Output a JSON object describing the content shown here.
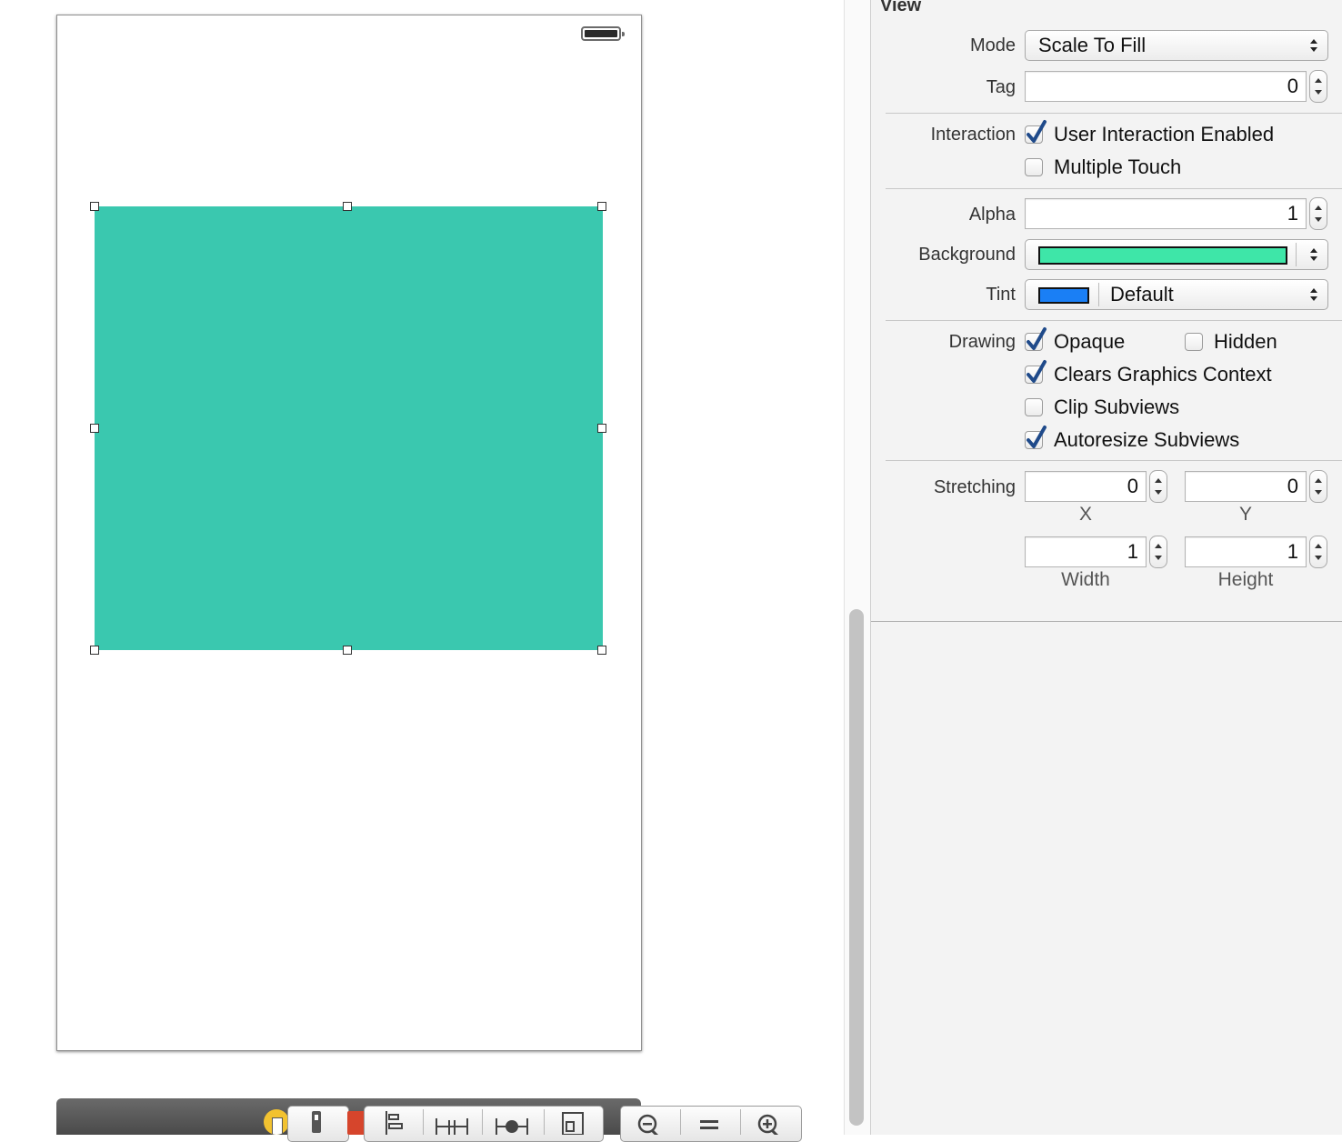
{
  "inspector": {
    "section_title": "View",
    "mode": {
      "label": "Mode",
      "value": "Scale To Fill"
    },
    "tag": {
      "label": "Tag",
      "value": "0"
    },
    "interaction": {
      "label": "Interaction",
      "user_interaction_enabled": {
        "label": "User Interaction Enabled",
        "checked": true
      },
      "multiple_touch": {
        "label": "Multiple Touch",
        "checked": false
      }
    },
    "alpha": {
      "label": "Alpha",
      "value": "1"
    },
    "background": {
      "label": "Background",
      "color": "#3ee6a8"
    },
    "tint": {
      "label": "Tint",
      "value": "Default",
      "color": "#1a7ff5"
    },
    "drawing": {
      "label": "Drawing",
      "opaque": {
        "label": "Opaque",
        "checked": true
      },
      "hidden": {
        "label": "Hidden",
        "checked": false
      },
      "clears_graphics_context": {
        "label": "Clears Graphics Context",
        "checked": true
      },
      "clip_subviews": {
        "label": "Clip Subviews",
        "checked": false
      },
      "autoresize_subviews": {
        "label": "Autoresize Subviews",
        "checked": true
      }
    },
    "stretching": {
      "label": "Stretching",
      "x": {
        "value": "0",
        "caption": "X"
      },
      "y": {
        "value": "0",
        "caption": "Y"
      },
      "width": {
        "value": "1",
        "caption": "Width"
      },
      "height": {
        "value": "1",
        "caption": "Height"
      }
    }
  },
  "canvas": {
    "view_color": "#3ac8af"
  },
  "toolbar": {
    "icons": [
      "document-outline-icon",
      "simulated-metrics-icon",
      "align-icon",
      "pin-icon",
      "resolve-icon",
      "resizing-icon",
      "zoom-out-icon",
      "zoom-actual-icon",
      "zoom-in-icon"
    ]
  }
}
